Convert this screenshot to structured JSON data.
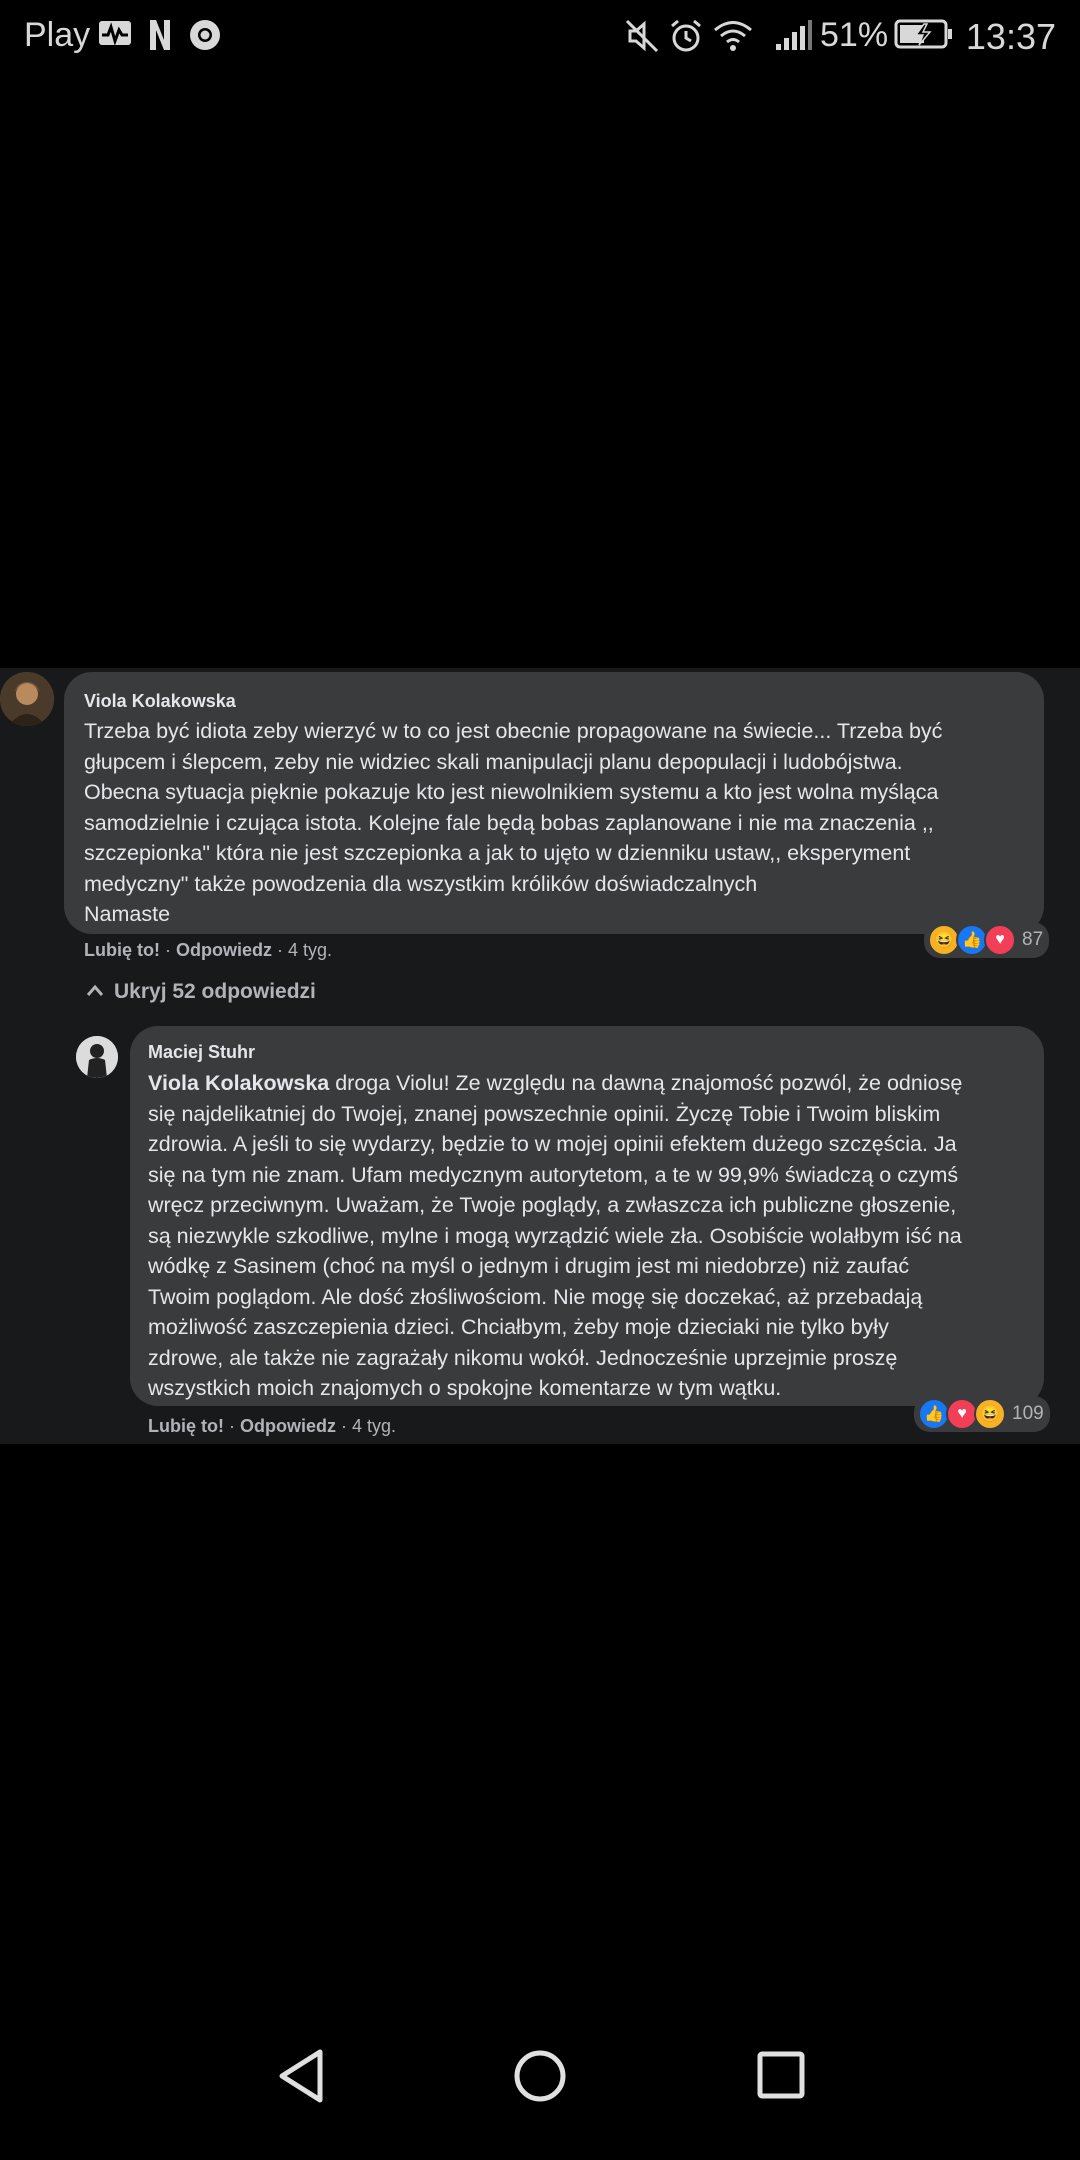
{
  "status_bar": {
    "carrier": "Play",
    "battery": "51%",
    "time": "13:37"
  },
  "comment": {
    "author": "Viola Kolakowska",
    "text": "Trzeba być idiota zeby wierzyć w to co jest obecnie propagowane na świecie... Trzeba być\ngłupcem i ślepcem, zeby nie widziec skali manipulacji planu depopulacji i ludobójstwa.\nObecna sytuacja pięknie pokazuje kto jest niewolnikiem systemu a kto jest wolna myśląca\nsamodzielnie i czująca istota. Kolejne fale będą bobas zaplanowane i nie ma znaczenia ,,\nszczepionka\" która nie jest szczepionka a jak to ujęto w dzienniku ustaw,, eksperyment\nmedyczny\" także powodzenia dla wszystkim królików doświadczalnych\nNamaste",
    "like_label": "Lubię to!",
    "reply_label": "Odpowiedz",
    "time": "4 tyg.",
    "reaction_count": "87"
  },
  "hide_replies_label": "Ukryj 52 odpowiedzi",
  "reply": {
    "author": "Maciej Stuhr",
    "mention": "Viola Kolakowska",
    "text": " droga Violu! Ze względu na dawną znajomość pozwól, że odniosę\nsię najdelikatniej do Twojej, znanej powszechnie opinii. Życzę Tobie i Twoim bliskim\nzdrowia. A jeśli to się wydarzy, będzie to w mojej opinii efektem dużego szczęścia. Ja\nsię na tym nie znam. Ufam medycznym autorytetom, a te w 99,9% świadczą o czymś\nwręcz przeciwnym. Uważam, że Twoje poglądy, a zwłaszcza ich publiczne głoszenie,\nsą niezwykle szkodliwe, mylne i mogą wyrządzić wiele zła. Osobiście wolałbym iść na\nwódkę z Sasinem (choć na myśl o jednym i drugim jest mi niedobrze) niż zaufać\nTwoim poglądom. Ale dość złośliwościom. Nie mogę się doczekać, aż przebadają\nmożliwość zaszczepienia dzieci. Chciałbym, żeby moje dzieciaki nie tylko były\nzdrowe, ale także nie zagrażały nikomu wokół. Jednocześnie uprzejmie proszę\nwszystkich moich znajomych o spokojne komentarze w tym wątku.",
    "like_label": "Lubię to!",
    "reply_label": "Odpowiedz",
    "time": "4 tyg.",
    "reaction_count": "109"
  },
  "colors": {
    "panel_bg": "#18191a",
    "bubble_bg": "#3a3b3c",
    "like_blue": "#1877f2",
    "love_red": "#f33e58",
    "haha_yellow": "#f7b125"
  }
}
